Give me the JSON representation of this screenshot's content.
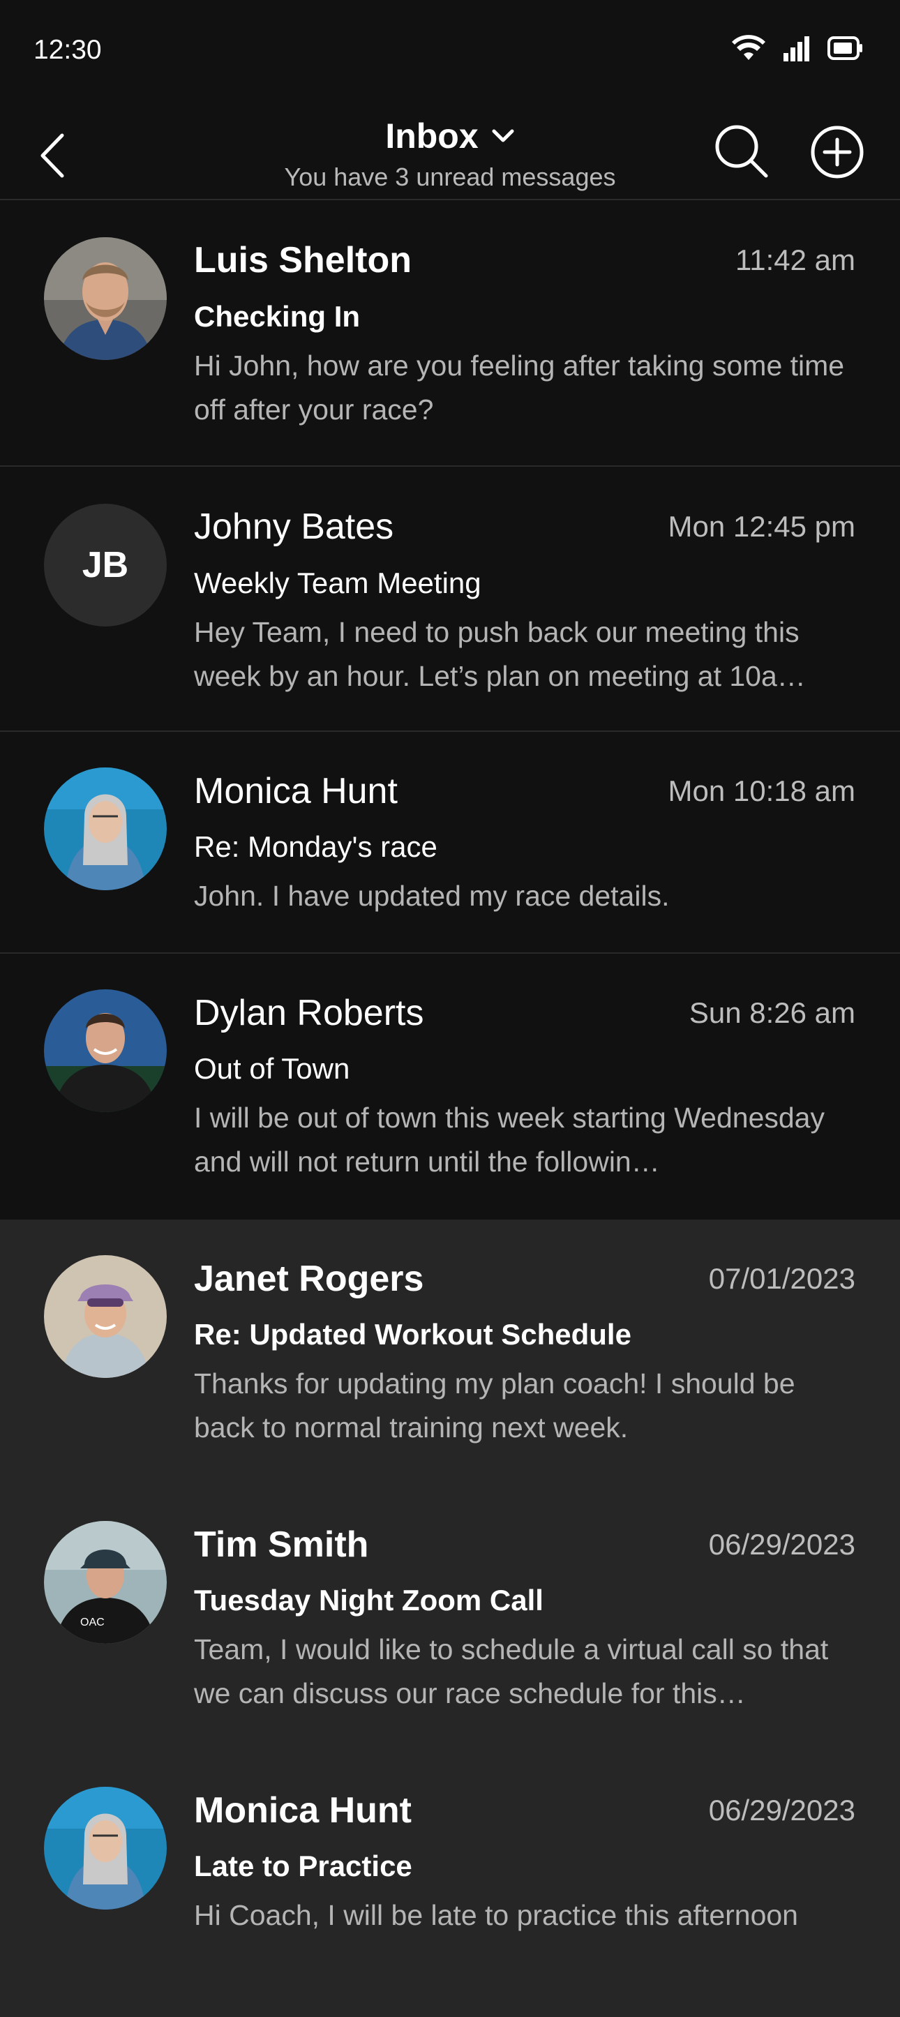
{
  "status_bar": {
    "time": "12:30"
  },
  "header": {
    "title": "Inbox",
    "subtitle": "You have 3 unread messages"
  },
  "messages": [
    {
      "sender": "Luis Shelton",
      "time": "11:42 am",
      "subject": "Checking In",
      "preview": "Hi John, how are you feeling after taking some time off after your race?",
      "unread": true,
      "avatar_type": "photo"
    },
    {
      "sender": "Johny Bates",
      "time": "Mon 12:45 pm",
      "subject": "Weekly Team Meeting",
      "preview": "Hey Team, I need to push back our meeting this week by an hour.  Let’s plan on meeting at 10a…",
      "unread": false,
      "avatar_type": "initials",
      "initials": "JB"
    },
    {
      "sender": "Monica Hunt",
      "time": "Mon 10:18 am",
      "subject": "Re: Monday's race",
      "preview": "John. I have updated my race details.",
      "unread": false,
      "avatar_type": "photo"
    },
    {
      "sender": "Dylan Roberts",
      "time": "Sun 8:26 am",
      "subject": "Out of Town",
      "preview": "I will be out of town this week starting Wednesday and will not return until the followin…",
      "unread": false,
      "avatar_type": "photo"
    },
    {
      "sender": "Janet Rogers",
      "time": "07/01/2023",
      "subject": "Re: Updated Workout Schedule",
      "preview": "Thanks for updating my plan coach!  I should be back to normal training next week.",
      "unread": true,
      "avatar_type": "photo"
    },
    {
      "sender": "Tim Smith",
      "time": "06/29/2023",
      "subject": "Tuesday Night Zoom Call",
      "preview": "Team, I would like to schedule a virtual call so that we can discuss our race schedule for this…",
      "unread": true,
      "avatar_type": "photo"
    },
    {
      "sender": "Monica Hunt",
      "time": "06/29/2023",
      "subject": "Late to Practice",
      "preview": "Hi Coach, I will be late to practice this afternoon",
      "unread": true,
      "avatar_type": "photo"
    }
  ],
  "colors": {
    "background": "#111111",
    "read_row": "#262626",
    "secondary_text": "#b5b5b5"
  },
  "icons": [
    "back-icon",
    "chevron-down-icon",
    "search-icon",
    "compose-icon",
    "wifi-icon",
    "signal-icon",
    "battery-icon"
  ]
}
